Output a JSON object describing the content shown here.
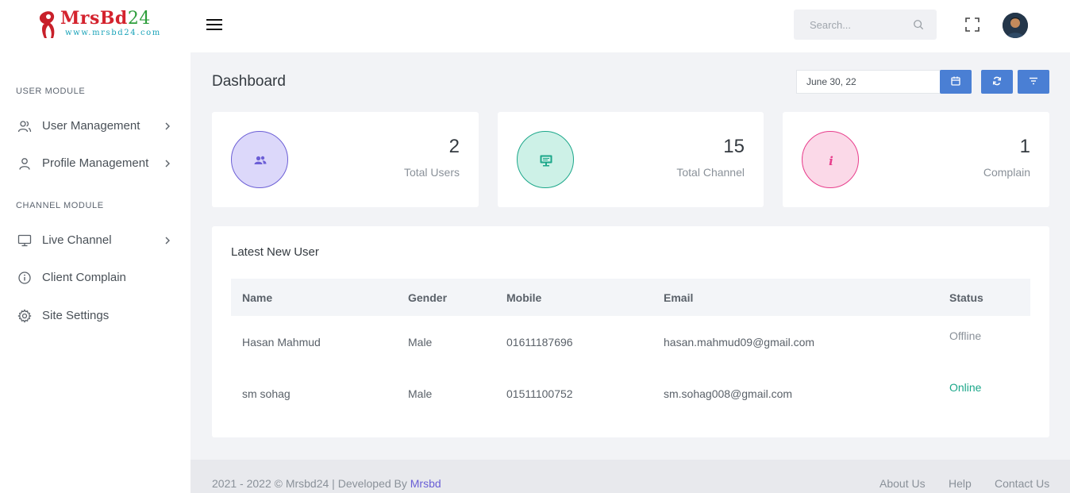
{
  "header": {
    "logo_text": "MrsBd",
    "logo_number": "24",
    "logo_url": "www.mrsbd24.com",
    "search_placeholder": "Search..."
  },
  "sidebar": {
    "sections": [
      {
        "title": "USER MODULE",
        "items": [
          {
            "label": "User Management",
            "icon": "users-icon",
            "has_children": true
          },
          {
            "label": "Profile Management",
            "icon": "user-icon",
            "has_children": true
          }
        ]
      },
      {
        "title": "CHANNEL MODULE",
        "items": [
          {
            "label": "Live Channel",
            "icon": "monitor-icon",
            "has_children": true
          },
          {
            "label": "Client Complain",
            "icon": "info-icon",
            "has_children": false
          },
          {
            "label": "Site Settings",
            "icon": "gear-icon",
            "has_children": false
          }
        ]
      }
    ]
  },
  "main": {
    "title": "Dashboard",
    "date_value": "June 30, 22",
    "stats": [
      {
        "value": "2",
        "label": "Total Users",
        "icon": "users-icon",
        "color": "#6c5fd6"
      },
      {
        "value": "15",
        "label": "Total Channel",
        "icon": "monitor-icon",
        "color": "#1ca78a"
      },
      {
        "value": "1",
        "label": "Complain",
        "icon": "info-icon",
        "color": "#e83e8c"
      }
    ],
    "table": {
      "title": "Latest New User",
      "columns": [
        "Name",
        "Gender",
        "Mobile",
        "Email",
        "Status"
      ],
      "rows": [
        [
          "Hasan Mahmud",
          "Male",
          "01611187696",
          "hasan.mahmud09@gmail.com",
          "Offline"
        ],
        [
          "sm sohag",
          "Male",
          "01511100752",
          "sm.sohag008@gmail.com",
          "Online"
        ]
      ]
    }
  },
  "footer": {
    "copyright": "2021 - 2022 © Mrsbd24 | Developed By ",
    "developer": "Mrsbd",
    "links": [
      "About Us",
      "Help",
      "Contact Us"
    ]
  },
  "colors": {
    "primary_button": "#4a7fd4",
    "online": "#1ca78a",
    "offline": "#8a9199"
  }
}
